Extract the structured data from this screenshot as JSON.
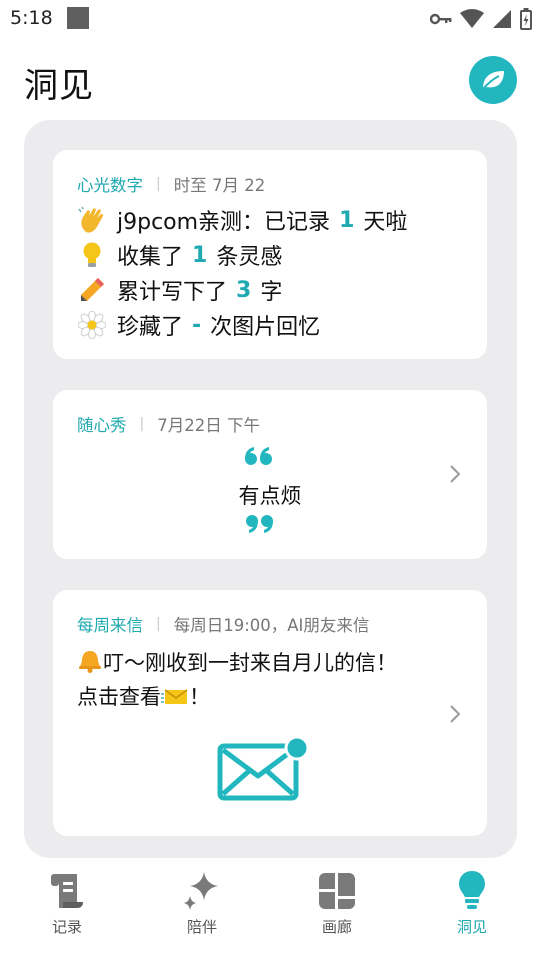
{
  "status_bar": {
    "time": "5:18"
  },
  "header": {
    "title": "洞见"
  },
  "cards": {
    "stats": {
      "tag": "心光数字",
      "meta": "时至 7月 22",
      "line1": {
        "prefix": "j9pcom亲测：已记录",
        "number": "1",
        "suffix": "天啦"
      },
      "line2": {
        "prefix": "收集了",
        "number": "1",
        "suffix": "条灵感"
      },
      "line3": {
        "prefix": "累计写下了",
        "number": "3",
        "suffix": "字"
      },
      "line4": {
        "prefix": "珍藏了",
        "number": "-",
        "suffix": "次图片回忆"
      }
    },
    "mood": {
      "tag": "随心秀",
      "meta": "7月22日 下午",
      "text": "有点烦"
    },
    "letter": {
      "tag": "每周来信",
      "meta": "每周日19:00，AI朋友来信",
      "text_a": "叮～刚收到一封来自月儿的信！点击查看",
      "text_b": "！"
    }
  },
  "bottom_nav": [
    {
      "label": "记录",
      "icon": "scroll-icon",
      "active": false
    },
    {
      "label": "陪伴",
      "icon": "sparkle-icon",
      "active": false
    },
    {
      "label": "画廊",
      "icon": "gallery-icon",
      "active": false
    },
    {
      "label": "洞见",
      "icon": "bulb-icon",
      "active": true
    }
  ],
  "colors": {
    "accent": "#1fa9b0",
    "panel": "#ececee",
    "card": "#ffffff"
  }
}
